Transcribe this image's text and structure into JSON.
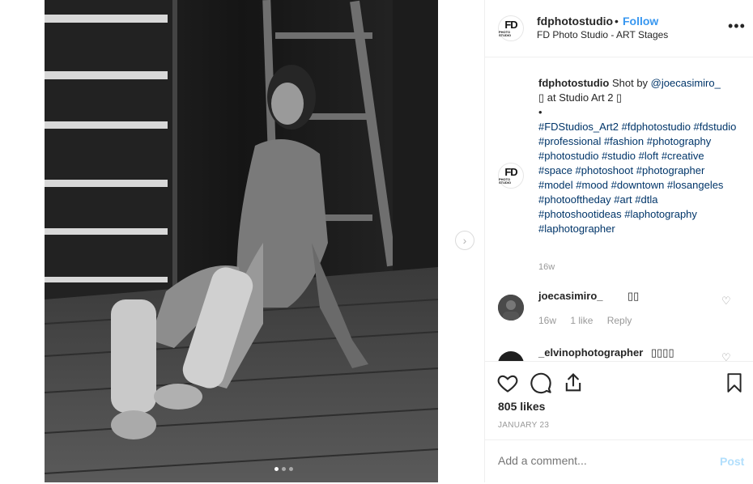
{
  "post": {
    "username": "fdphotostudio",
    "separator": "•",
    "follow_label": "Follow",
    "location": "FD Photo Studio - ART Stages",
    "more_icon": "more-options-icon",
    "logo_line1": "FD",
    "logo_line2": "PHOTO STUDIO",
    "carousel_total": 3,
    "carousel_active": 1
  },
  "caption": {
    "username": "fdphotostudio",
    "text_1": " Shot by ",
    "mention": "@joecasimiro_",
    "text_2": "\n▯ at Studio Art 2 ▯",
    "bullet": "•",
    "hashtags": [
      "#FDStudios_Art2",
      "#fdphotostudio",
      "#fdstudio",
      "#professional",
      "#fashion",
      "#photography",
      "#photostudio",
      "#studio",
      "#loft",
      "#creative",
      "#space",
      "#photoshoot",
      "#photographer",
      "#model",
      "#mood",
      "#downtown",
      "#losangeles",
      "#photooftheday",
      "#art",
      "#dtla",
      "#photoshootideas",
      "#laphotography",
      "#laphotographer"
    ],
    "time": "16w"
  },
  "comments": [
    {
      "username": "joecasimiro_",
      "text": "▯▯",
      "time": "16w",
      "likes": "1 like",
      "reply": "Reply"
    },
    {
      "username": "_elvinophotographer",
      "text": "▯▯▯▯"
    }
  ],
  "actions": {
    "likes": "805 likes",
    "date": "JANUARY 23",
    "comment_placeholder": "Add a comment...",
    "post_label": "Post"
  },
  "colors": {
    "link": "#003569",
    "follow": "#3897f0",
    "post_disabled": "#b2dffc"
  }
}
